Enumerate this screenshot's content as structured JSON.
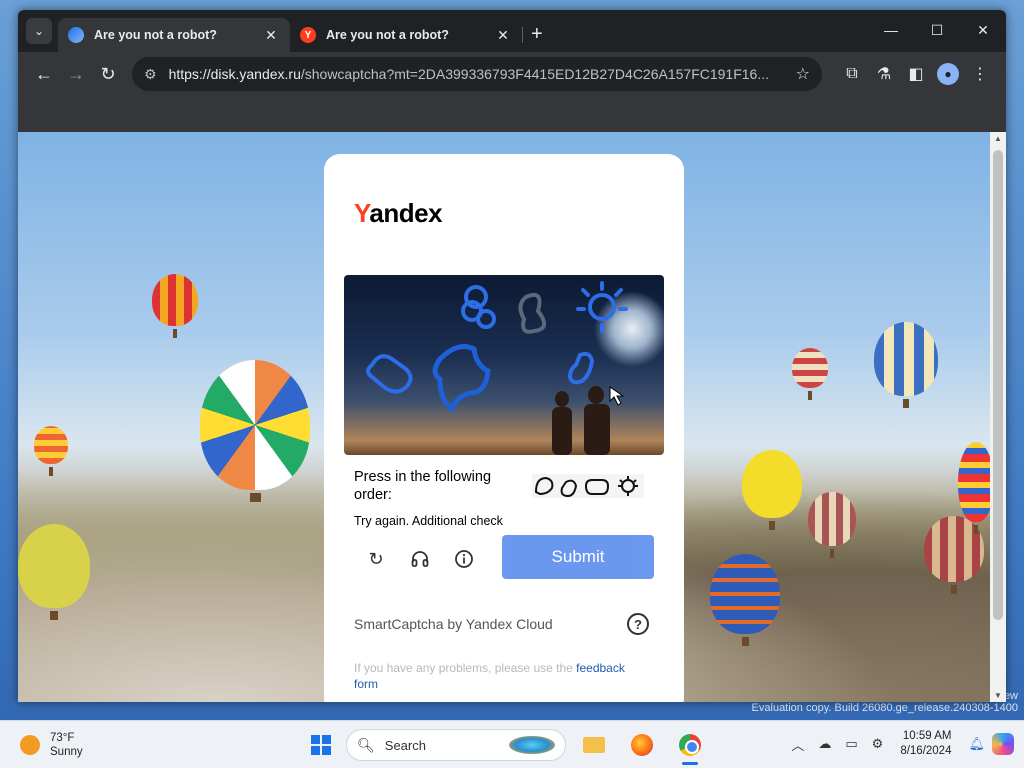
{
  "browser": {
    "tabs": [
      {
        "title": "Are you not a robot?",
        "active": true,
        "icon": "globe-icon"
      },
      {
        "title": "Are you not a robot?",
        "active": false,
        "icon": "yandex-icon"
      }
    ],
    "url_host": "https://disk.yandex.ru",
    "url_path": "/showcaptcha?mt=2DA399336793F4415ED12B27D4C26A157FC191F16..."
  },
  "captcha": {
    "logo_first": "Y",
    "logo_rest": "andex",
    "instruction": "Press in the following order:",
    "warning": "Try again. Additional check",
    "submit_label": "Submit",
    "brand": "SmartCaptcha by Yandex Cloud",
    "help_symbol": "?",
    "problems_text": "If you have any problems, please use the ",
    "feedback_link": "feedback form"
  },
  "desktop": {
    "eval_line1": "ew",
    "eval_line2": "Evaluation copy. Build 26080.ge_release.240308-1400"
  },
  "taskbar": {
    "temperature": "73°F",
    "condition": "Sunny",
    "search_label": "Search",
    "time": "10:59 AM",
    "date": "8/16/2024"
  },
  "colors": {
    "submit_bg": "#5c8dee",
    "yandex_red": "#fc3f1d",
    "link_blue": "#1f5bb0"
  }
}
